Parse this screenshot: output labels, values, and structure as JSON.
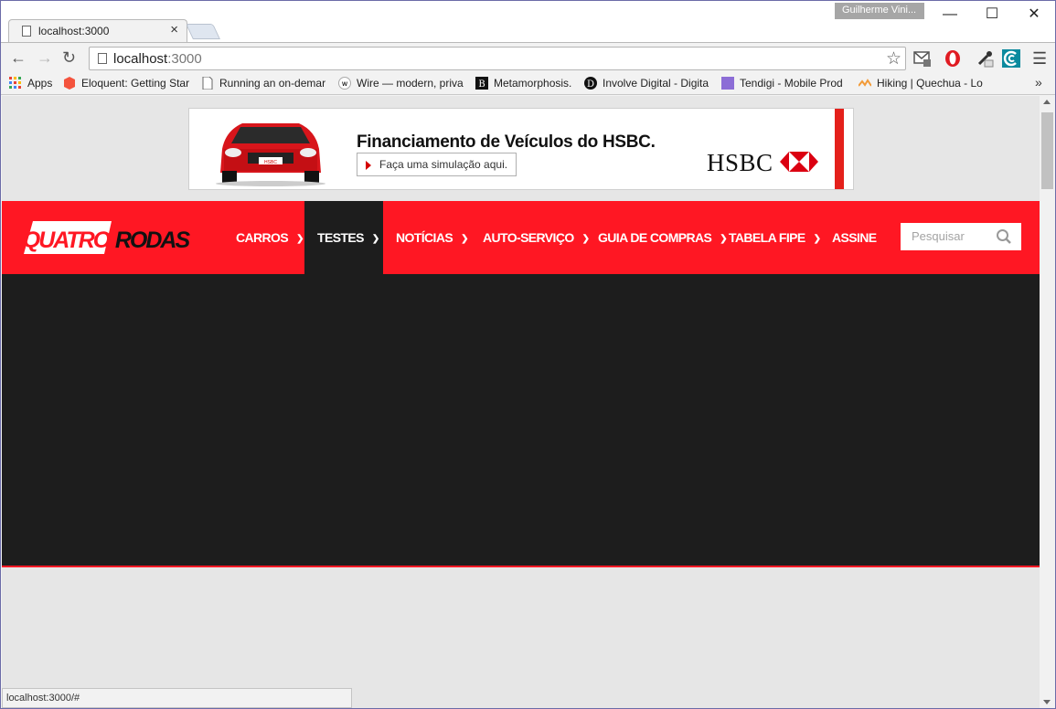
{
  "browser": {
    "tab_title": "localhost:3000",
    "profile_name": "Guilherme Vini...",
    "url_host": "localhost",
    "url_port": ":3000",
    "status_url": "localhost:3000/#",
    "window_controls": {
      "minimize": "—",
      "maximize": "☐",
      "close": "✕"
    }
  },
  "bookmarks": [
    {
      "label": "Apps",
      "icon": "apps-grid-icon"
    },
    {
      "label": "Eloquent: Getting Star",
      "icon": "laravel-icon"
    },
    {
      "label": "Running an on-demar",
      "icon": "page-icon"
    },
    {
      "label": "Wire — modern, priva",
      "icon": "wire-icon"
    },
    {
      "label": "Metamorphosis.",
      "icon": "b-icon"
    },
    {
      "label": "Involve Digital - Digita",
      "icon": "d-icon"
    },
    {
      "label": "Tendigi - Mobile Prod",
      "icon": "tendigi-icon"
    },
    {
      "label": "Hiking | Quechua - Lo",
      "icon": "quechua-icon"
    }
  ],
  "ad": {
    "headline": "Financiamento de Veículos do HSBC.",
    "cta": "Faça uma simulação aqui.",
    "brand": "HSBC",
    "plate": "HSBC"
  },
  "site": {
    "logo_left": "QUATRO",
    "logo_right": "RODAS",
    "nav": [
      {
        "label": "CARROS",
        "dropdown": true,
        "active": false
      },
      {
        "label": "TESTES",
        "dropdown": true,
        "active": true
      },
      {
        "label": "NOTÍCIAS",
        "dropdown": true,
        "active": false
      },
      {
        "label": "AUTO-SERVIÇO",
        "dropdown": true,
        "active": false
      },
      {
        "label": "GUIA DE COMPRAS",
        "dropdown": true,
        "active": false
      },
      {
        "label": "TABELA FIPE",
        "dropdown": true,
        "active": false
      },
      {
        "label": "ASSINE",
        "dropdown": false,
        "active": false
      }
    ],
    "search_placeholder": "Pesquisar"
  },
  "colors": {
    "brand_red": "#ff1723",
    "hero_dark": "#1d1d1d",
    "page_bg": "#e6e6e6"
  }
}
